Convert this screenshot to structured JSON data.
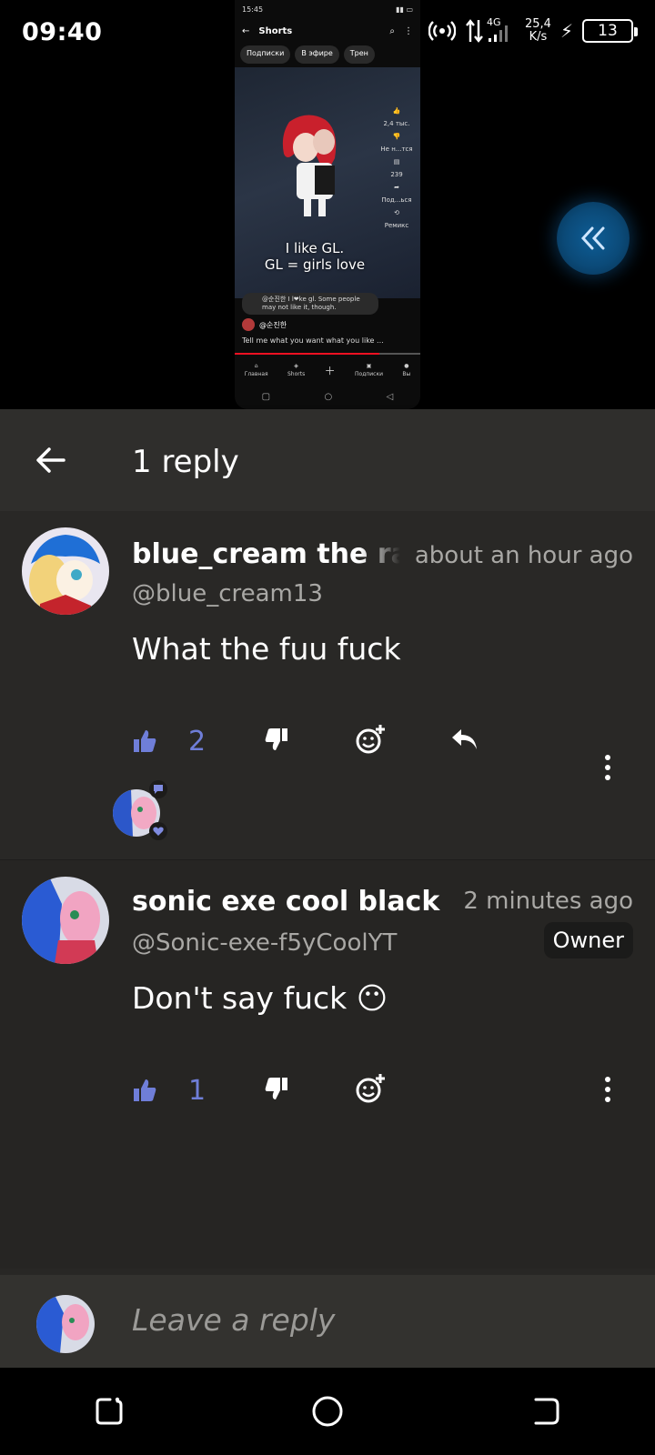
{
  "status_bar": {
    "time": "09:40",
    "network": "4G",
    "speed_value": "25,4",
    "speed_unit": "K/s",
    "battery": "13"
  },
  "video_preview": {
    "status_time": "15:45",
    "title": "Shorts",
    "chips": [
      "Подписки",
      "В эфире",
      "Трен"
    ],
    "caption_line1": "I like GL.",
    "caption_line2": "GL = girls love",
    "likes": "2,4 тыс.",
    "dislike_label": "Не н...тся",
    "comments_count": "239",
    "share_label": "Под...ься",
    "remix_label": "Ремикс",
    "pinned_comment": "@순진한   I l❤ke gl. Some people may not like it, though.",
    "author": "@순진한",
    "description": "Tell me what you want what you like  ...",
    "nav": [
      "Главная",
      "Shorts",
      "",
      "Подписки",
      "Вы"
    ]
  },
  "header": {
    "title": "1 reply"
  },
  "comments": [
    {
      "author": "blue_cream the ra",
      "handle": "@blue_cream13",
      "time": "about an hour ago",
      "text": "What the fuu fuck",
      "likes": "2"
    },
    {
      "author": "sonic exe cool black",
      "handle": "@Sonic-exe-f5yCoolYT",
      "time": "2 minutes ago",
      "badge": "Owner",
      "text": "Don't say fuck 😶",
      "likes": "1"
    }
  ],
  "reply_bar": {
    "placeholder": "Leave a reply"
  },
  "colors": {
    "sheet_bg": "#282725",
    "accent_like": "#6f7ed8",
    "float_button": "#0e5d96"
  }
}
